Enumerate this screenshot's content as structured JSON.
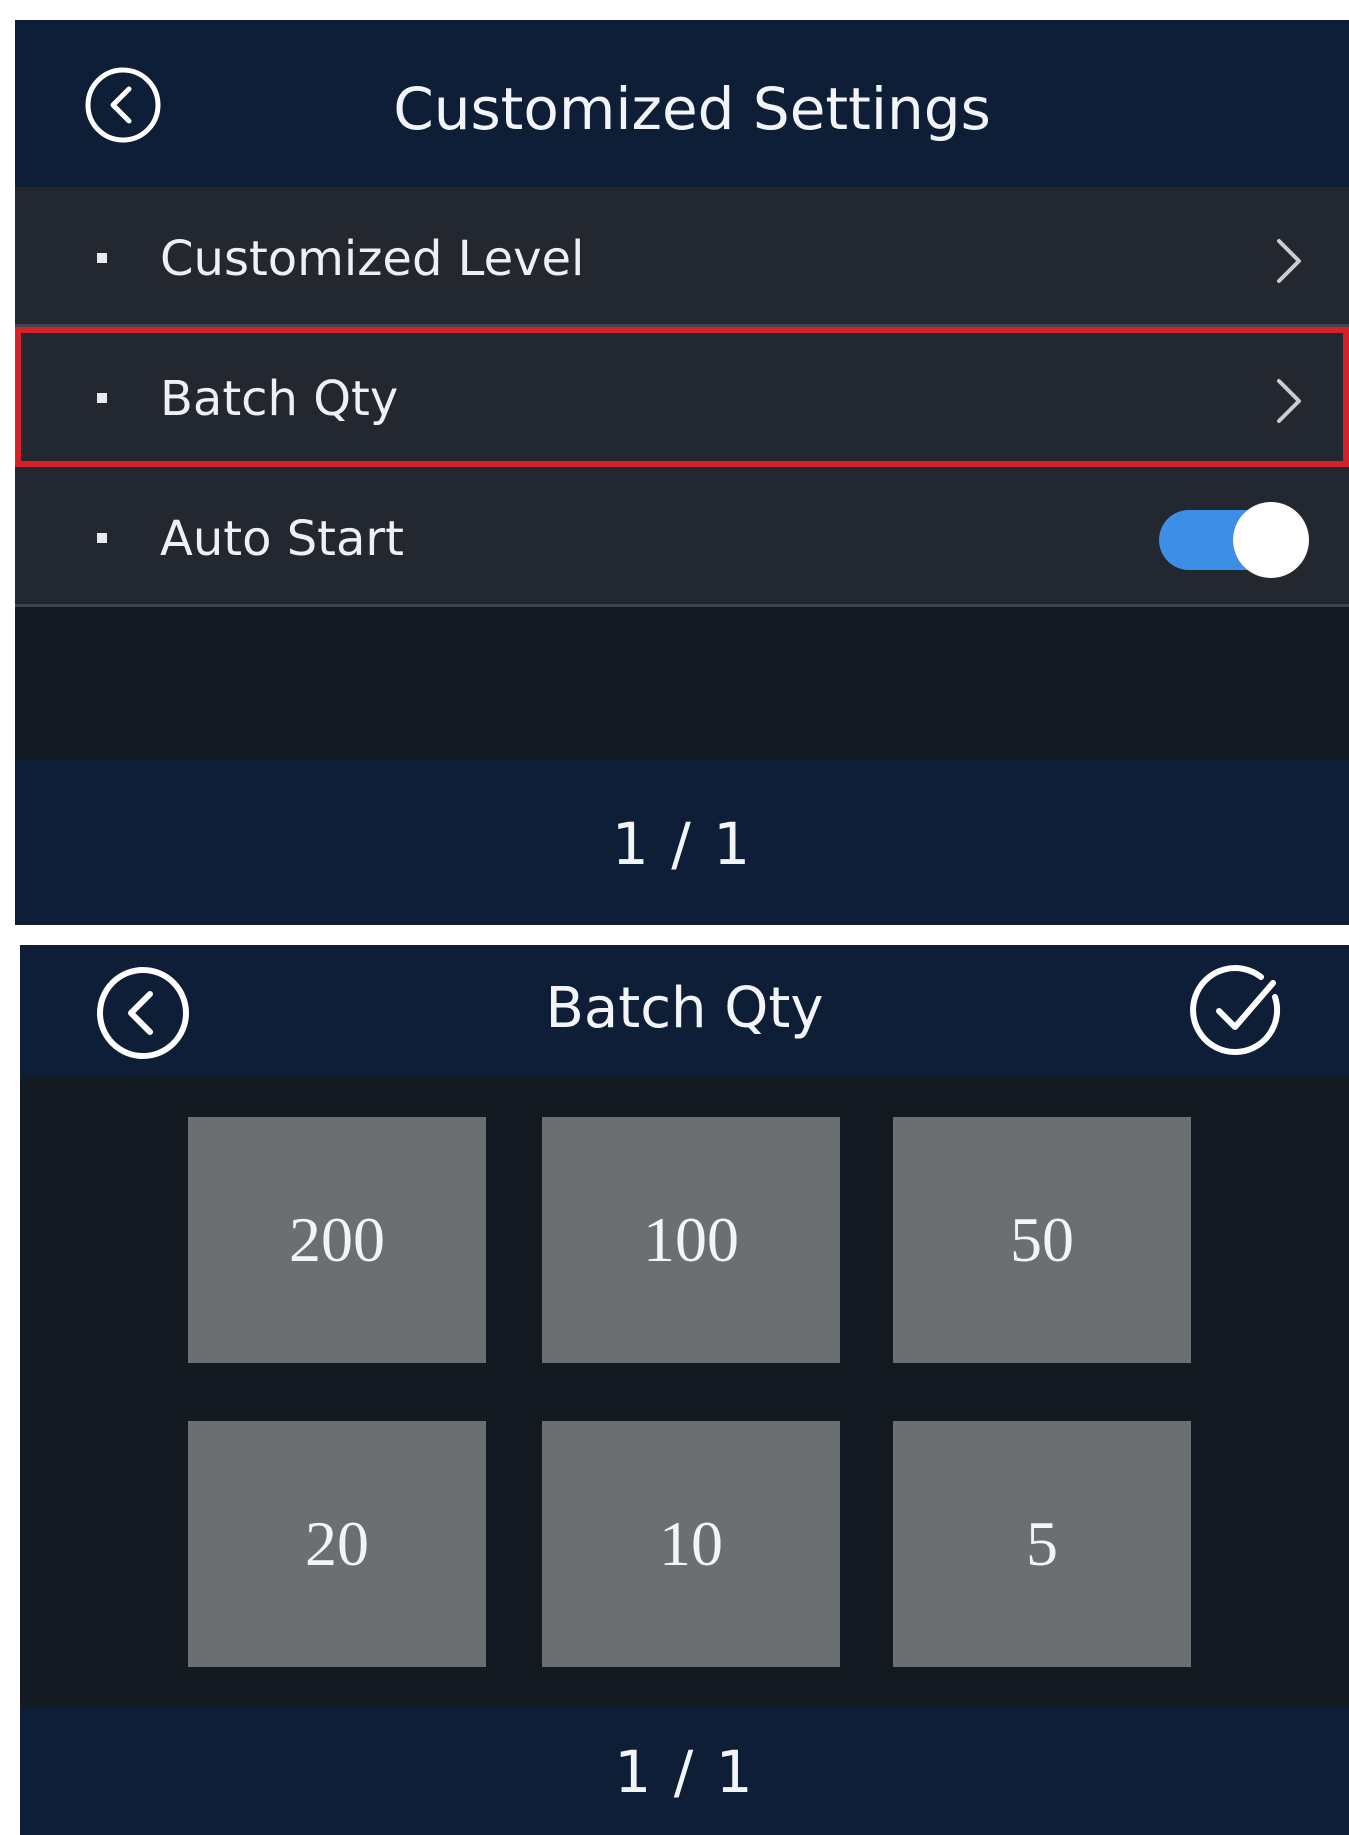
{
  "settings_screen": {
    "title": "Customized Settings",
    "back_icon": "circle-chevron-left-icon",
    "items": [
      {
        "label": "Customized Level",
        "control": "chevron",
        "icon": "chevron-right-icon"
      },
      {
        "label": "Batch Qty",
        "control": "chevron",
        "icon": "chevron-right-icon",
        "highlighted": true
      },
      {
        "label": "Auto Start",
        "control": "toggle",
        "toggle_on": true
      }
    ],
    "pagination": "1 / 1"
  },
  "batch_screen": {
    "title": "Batch Qty",
    "back_icon": "circle-chevron-left-icon",
    "confirm_icon": "circle-check-icon",
    "options": [
      "200",
      "100",
      "50",
      "20",
      "10",
      "5"
    ],
    "pagination": "1 / 1"
  },
  "colors": {
    "header_bg": "#0d1e36",
    "row_bg": "#23272f",
    "body_bg": "#131a22",
    "highlight": "#d5202a",
    "toggle_on": "#3c8ee6",
    "tile_bg": "#6c6f72"
  }
}
